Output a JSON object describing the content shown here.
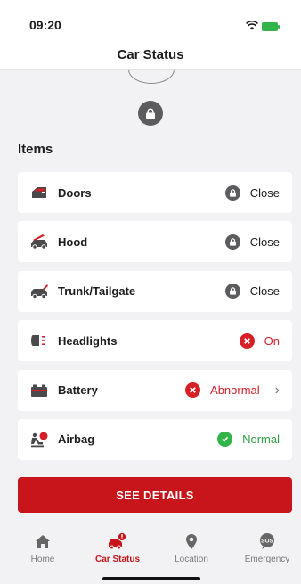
{
  "status_bar": {
    "time": "09:20",
    "signal_dots": "....",
    "wifi_icon": "wifi-icon",
    "battery_icon": "battery-charging-icon",
    "battery_color": "#33b449"
  },
  "header": {
    "title": "Car Status"
  },
  "car_lock": {
    "icon": "lock-icon"
  },
  "section": {
    "title": "Items"
  },
  "items": [
    {
      "label": "Doors",
      "icon": "car-door-icon",
      "status_icon": "lock-icon",
      "status": "Close",
      "state": "neutral"
    },
    {
      "label": "Hood",
      "icon": "car-hood-icon",
      "status_icon": "lock-icon",
      "status": "Close",
      "state": "neutral"
    },
    {
      "label": "Trunk/Tailgate",
      "icon": "car-trunk-icon",
      "status_icon": "lock-icon",
      "status": "Close",
      "state": "neutral"
    },
    {
      "label": "Headlights",
      "icon": "headlight-icon",
      "status_icon": "error-x-icon",
      "status": "On",
      "state": "error"
    },
    {
      "label": "Battery",
      "icon": "car-battery-icon",
      "status_icon": "error-x-icon",
      "status": "Abnormal",
      "state": "error",
      "has_chevron": true
    },
    {
      "label": "Airbag",
      "icon": "airbag-icon",
      "status_icon": "check-icon",
      "status": "Normal",
      "state": "ok"
    }
  ],
  "actions": {
    "details_label": "SEE DETAILS"
  },
  "tabs": [
    {
      "label": "Home",
      "icon": "home-icon",
      "active": false
    },
    {
      "label": "Car Status",
      "icon": "car-alert-icon",
      "active": true
    },
    {
      "label": "Location",
      "icon": "location-pin-icon",
      "active": false
    },
    {
      "label": "Emergency",
      "icon": "sos-icon",
      "active": false
    }
  ],
  "colors": {
    "accent": "#c8151b",
    "error": "#d61f26",
    "ok": "#33b449",
    "neutral_badge": "#5c5c5e"
  }
}
